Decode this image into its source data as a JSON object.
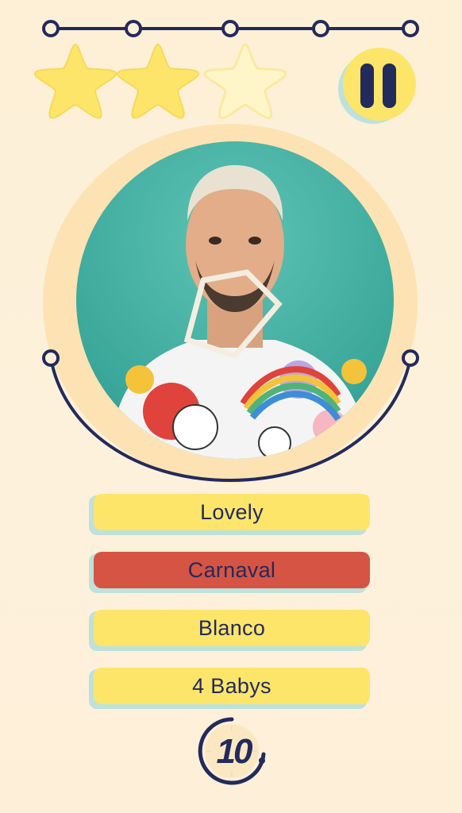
{
  "level_progress": {
    "dots": 5
  },
  "stars": {
    "earned": 2,
    "total": 3
  },
  "pause": {
    "label": "pause"
  },
  "portrait": {
    "alt": ""
  },
  "answers": [
    {
      "label": "Lovely",
      "state": "default"
    },
    {
      "label": "Carnaval",
      "state": "wrong"
    },
    {
      "label": "Blanco",
      "state": "default"
    },
    {
      "label": "4 Babys",
      "state": "default"
    }
  ],
  "timer": {
    "value": "10"
  },
  "colors": {
    "navy": "#232a5c",
    "star_filled": "#fde56a",
    "star_empty": "#fef6c9",
    "answer_default": "#fde56a",
    "answer_wrong": "#d65444",
    "background": "#fdf0d6"
  }
}
